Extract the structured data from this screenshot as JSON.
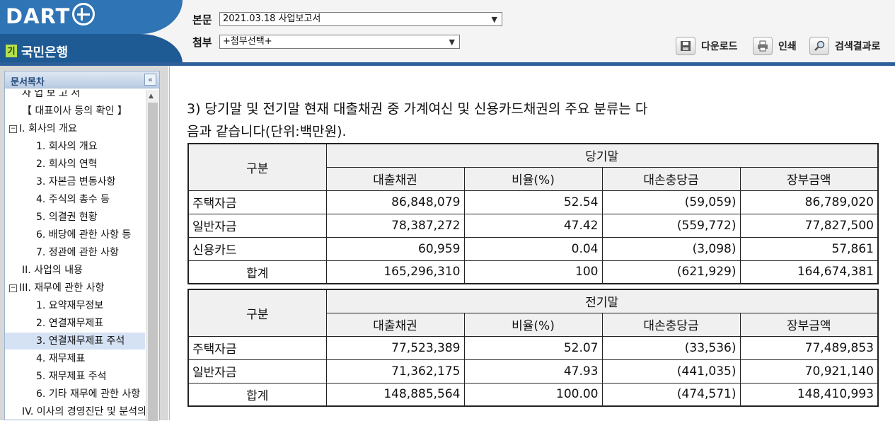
{
  "header": {
    "logo_text": "DART",
    "company_badge": "기",
    "company_name": "국민은행",
    "body_label": "본문",
    "body_select_value": "2021.03.18  사업보고서",
    "attach_label": "첨부",
    "attach_select_value": "+첨부선택+",
    "download_label": "다운로드",
    "print_label": "인쇄",
    "search_result_label": "검색결과로"
  },
  "sidebar": {
    "title": "문서목차",
    "items": [
      {
        "label": "사 업 보 고 서",
        "level": 1,
        "expander": ""
      },
      {
        "label": "【 대표이사 등의 확인 】",
        "level": 1,
        "expander": ""
      },
      {
        "label": "I. 회사의 개요",
        "level": 0,
        "expander": "−"
      },
      {
        "label": "1. 회사의 개요",
        "level": 2,
        "expander": ""
      },
      {
        "label": "2. 회사의 연혁",
        "level": 2,
        "expander": ""
      },
      {
        "label": "3. 자본금 변동사항",
        "level": 2,
        "expander": ""
      },
      {
        "label": "4. 주식의 총수 등",
        "level": 2,
        "expander": ""
      },
      {
        "label": "5. 의결권 현황",
        "level": 2,
        "expander": ""
      },
      {
        "label": "6. 배당에 관한 사항 등",
        "level": 2,
        "expander": ""
      },
      {
        "label": "7. 정관에 관한 사항",
        "level": 2,
        "expander": ""
      },
      {
        "label": "II. 사업의 내용",
        "level": 1,
        "expander": ""
      },
      {
        "label": "III. 재무에 관한 사항",
        "level": 0,
        "expander": "−"
      },
      {
        "label": "1. 요약재무정보",
        "level": 2,
        "expander": ""
      },
      {
        "label": "2. 연결재무제표",
        "level": 2,
        "expander": ""
      },
      {
        "label": "3. 연결재무제표 주석",
        "level": 2,
        "expander": "",
        "selected": true
      },
      {
        "label": "4. 재무제표",
        "level": 2,
        "expander": ""
      },
      {
        "label": "5. 재무제표 주석",
        "level": 2,
        "expander": ""
      },
      {
        "label": "6. 기타 재무에 관한 사항",
        "level": 2,
        "expander": ""
      },
      {
        "label": "IV. 이사의 경영진단 및 분석의견",
        "level": 1,
        "expander": ""
      }
    ]
  },
  "main": {
    "intro_line1": "3) 당기말 및 전기말 현재 대출채권 중 가계여신 및 신용카드채권의 주요 분류는 다",
    "intro_line2": "음과 같습니다(단위:백만원).",
    "tables": [
      {
        "corner": "구분",
        "period": "당기말",
        "columns": [
          "대출채권",
          "비율(%)",
          "대손충당금",
          "장부금액"
        ],
        "rows": [
          {
            "label": "주택자금",
            "values": [
              "86,848,079",
              "52.54",
              "(59,059)",
              "86,789,020"
            ]
          },
          {
            "label": "일반자금",
            "values": [
              "78,387,272",
              "47.42",
              "(559,772)",
              "77,827,500"
            ]
          },
          {
            "label": "신용카드",
            "values": [
              "60,959",
              "0.04",
              "(3,098)",
              "57,861"
            ]
          },
          {
            "label": "합계",
            "values": [
              "165,296,310",
              "100",
              "(621,929)",
              "164,674,381"
            ]
          }
        ]
      },
      {
        "corner": "구분",
        "period": "전기말",
        "columns": [
          "대출채권",
          "비율(%)",
          "대손충당금",
          "장부금액"
        ],
        "rows": [
          {
            "label": "주택자금",
            "values": [
              "77,523,389",
              "52.07",
              "(33,536)",
              "77,489,853"
            ]
          },
          {
            "label": "일반자금",
            "values": [
              "71,362,175",
              "47.93",
              "(441,035)",
              "70,921,140"
            ]
          },
          {
            "label": "합계",
            "values": [
              "148,885,564",
              "100.00",
              "(474,571)",
              "148,410,993"
            ]
          }
        ]
      }
    ]
  }
}
